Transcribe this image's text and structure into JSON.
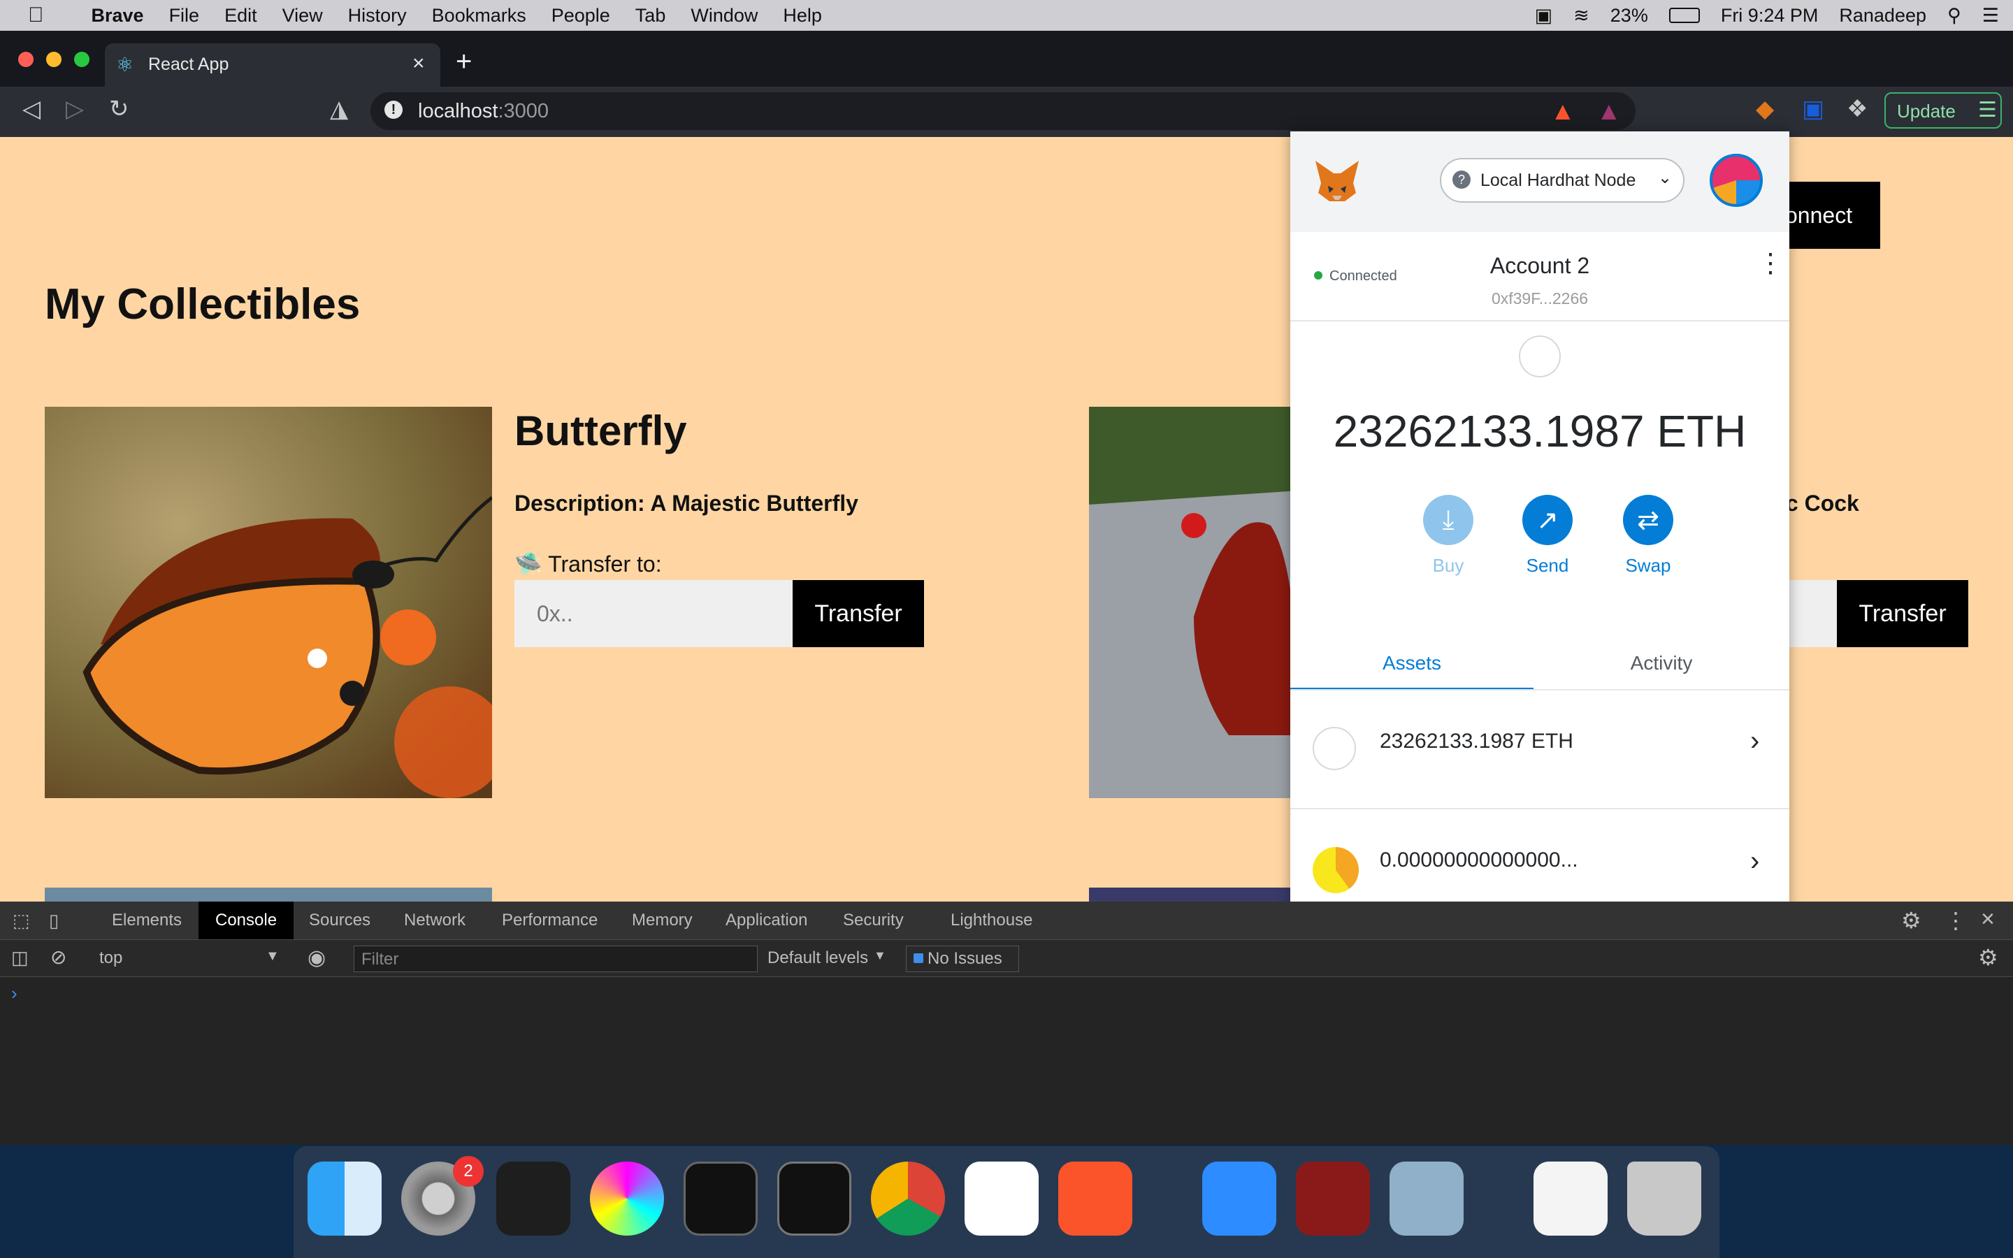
{
  "menubar": {
    "app": "Brave",
    "items": [
      "File",
      "Edit",
      "View",
      "History",
      "Bookmarks",
      "People",
      "Tab",
      "Window",
      "Help"
    ],
    "battery": "23%",
    "clock": "Fri 9:24 PM",
    "user": "Ranadeep"
  },
  "browser": {
    "tab_title": "React App",
    "url_host": "localhost",
    "url_port": ":3000",
    "update_label": "Update"
  },
  "page": {
    "title": "My Collectibles",
    "connect_label": "onnect",
    "cards": [
      {
        "title": "Butterfly",
        "description": "Description: A Majestic Butterfly",
        "transfer_label": "🛸 Transfer to:",
        "input_placeholder": "0x..",
        "button": "Transfer"
      },
      {
        "title": "",
        "description": "ic Cock",
        "transfer_label": "",
        "input_placeholder": "",
        "button": "Transfer"
      }
    ]
  },
  "metamask": {
    "network": "Local Hardhat Node",
    "connected": "Connected",
    "account_name": "Account 2",
    "account_address": "0xf39F...2266",
    "balance": "23262133.1987 ETH",
    "actions": [
      {
        "label": "Buy"
      },
      {
        "label": "Send"
      },
      {
        "label": "Swap"
      }
    ],
    "tabs": [
      "Assets",
      "Activity"
    ],
    "assets": [
      {
        "text": "23262133.1987 ETH"
      },
      {
        "text": "0.00000000000000..."
      }
    ]
  },
  "devtools": {
    "tabs": [
      "Elements",
      "Console",
      "Sources",
      "Network",
      "Performance",
      "Memory",
      "Application",
      "Security",
      "Lighthouse"
    ],
    "active_tab": "Console",
    "context": "top",
    "filter_placeholder": "Filter",
    "levels": "Default levels",
    "issues": "No Issues"
  },
  "dock": {
    "badge": "2"
  },
  "colors": {
    "page_bg": "#ffd6a3",
    "metamask_blue": "#037dd6",
    "connected_green": "#28a745"
  }
}
